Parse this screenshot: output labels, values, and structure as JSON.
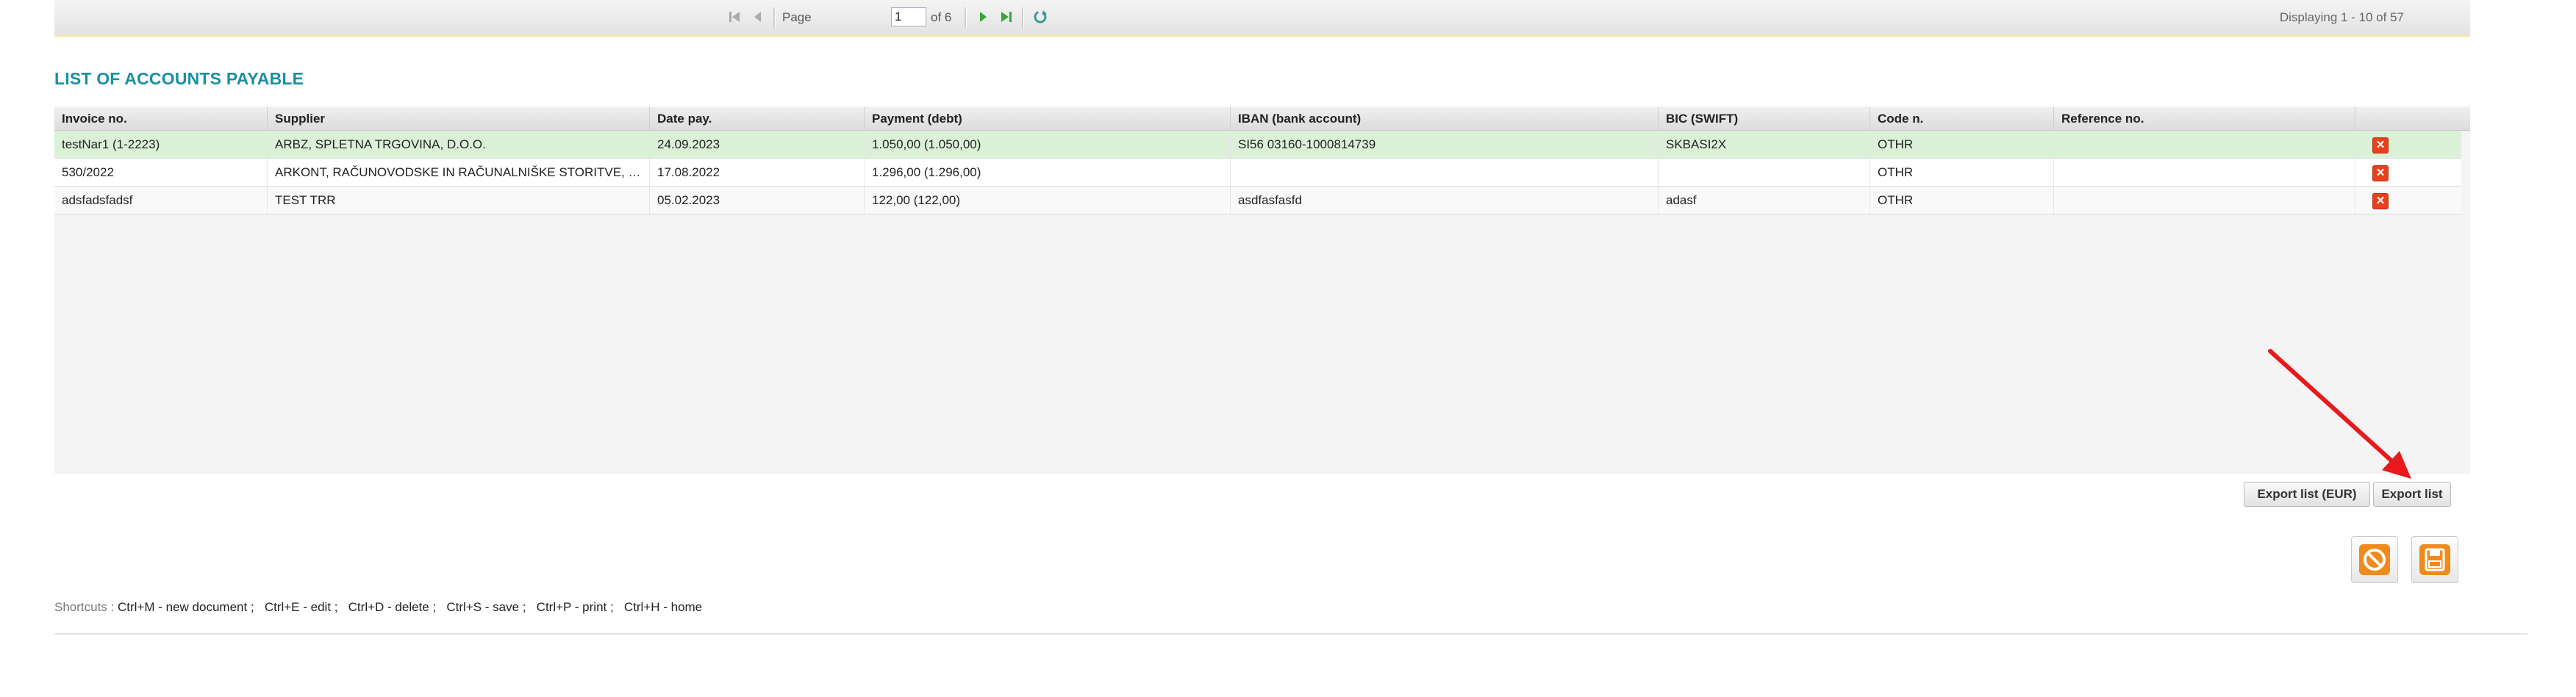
{
  "pager": {
    "page_label": "Page",
    "page_value": "1",
    "of_label": "of 6",
    "displaying": "Displaying 1 - 10 of 57",
    "icons": [
      "first-page-icon",
      "prev-page-icon",
      "next-page-icon",
      "last-page-icon",
      "refresh-icon"
    ]
  },
  "title": "LIST OF ACCOUNTS PAYABLE",
  "grid": {
    "columns": [
      "Invoice no.",
      "Supplier",
      "Date pay.",
      "Payment (debt)",
      "IBAN (bank account)",
      "BIC (SWIFT)",
      "Code n.",
      "Reference no."
    ],
    "rows": [
      {
        "invoice": "testNar1 (1-2223)",
        "supplier": "ARBZ, SPLETNA TRGOVINA, D.O.O.",
        "date": "24.09.2023",
        "payment": "1.050,00 (1.050,00)",
        "iban": "SI56 03160-1000814739",
        "bic": "SKBASI2X",
        "code": "OTHR",
        "ref": "",
        "selected": true
      },
      {
        "invoice": "530/2022",
        "supplier": "ARKONT, RAČUNOVODSKE IN RAČUNALNIŠKE STORITVE, D.O.O.",
        "date": "17.08.2022",
        "payment": "1.296,00 (1.296,00)",
        "iban": "",
        "bic": "",
        "code": "OTHR",
        "ref": "",
        "selected": false
      },
      {
        "invoice": "adsfadsfadsf",
        "supplier": "TEST TRR",
        "date": "05.02.2023",
        "payment": "122,00 (122,00)",
        "iban": "asdfasfasfd",
        "bic": "adasf",
        "code": "OTHR",
        "ref": "",
        "selected": false
      }
    ],
    "delete_icon": "delete-icon"
  },
  "buttons": {
    "export_eur": "Export list (EUR)",
    "export": "Export list",
    "cancel_icon": "cancel-icon",
    "save_icon": "save-icon"
  },
  "shortcuts": {
    "label": "Shortcuts :",
    "items": "Ctrl+M - new document ;   Ctrl+E - edit ;   Ctrl+D - delete ;   Ctrl+S - save ;   Ctrl+P - print ;   Ctrl+H - home"
  },
  "colors": {
    "title": "#1a8fa3",
    "selected_row": "#daf1d8",
    "delete": "#e8401c",
    "action_orange": "#f08a1c",
    "annotation_arrow": "#e8191b"
  }
}
